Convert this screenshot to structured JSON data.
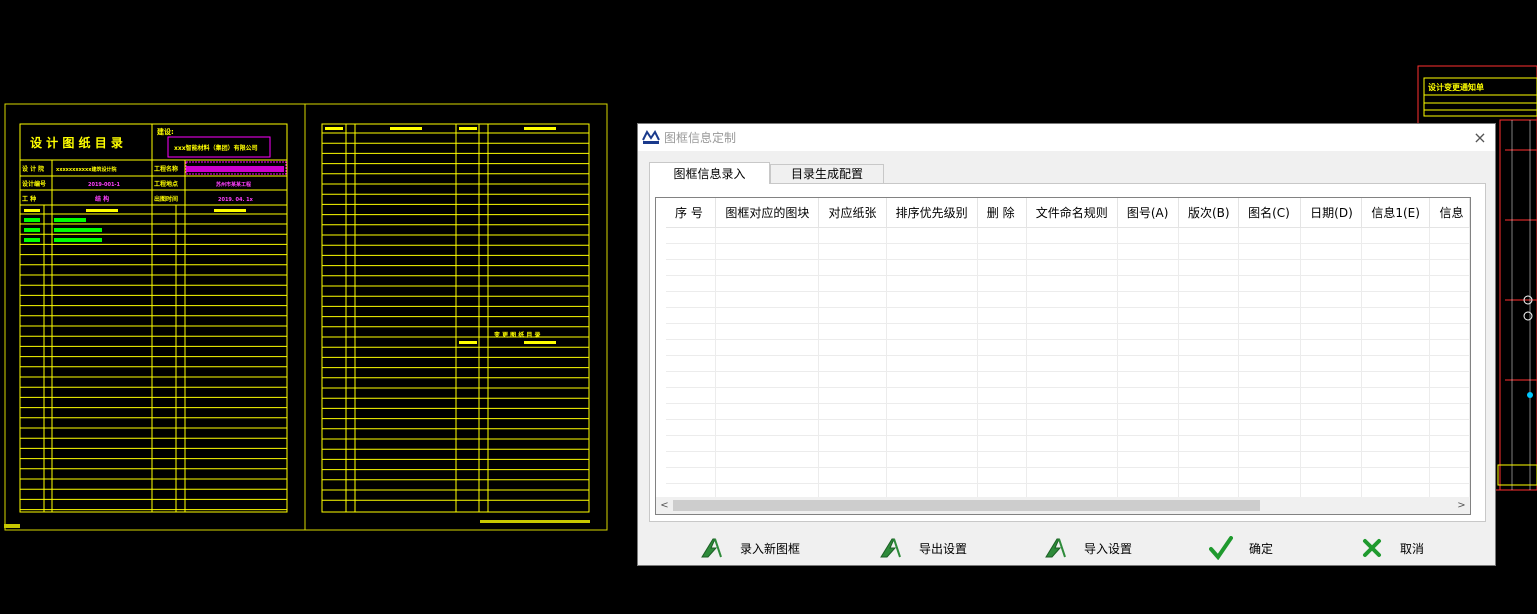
{
  "cad": {
    "catalog_title": "设 计 图 纸 目 录",
    "owner_label": "建设:",
    "company": "xxx智能材料（集团）有限公司",
    "row1_label": "设 计 院",
    "row1_value": "xxxxxxxxxxx建筑设计院",
    "row2_label": "设计编号",
    "row2_value": "2019-001-1",
    "row3_label": "工    种",
    "row3_value": "结 构",
    "project_name_label": "工程名称",
    "project_site_label": "工程地点",
    "project_site_value": "苏州市某某工程",
    "date_label": "出图时间",
    "date_value": "2019. 04. 1x",
    "right_sheet_note": "变 更 图 纸 目 录",
    "change_notice_title": "设计变更通知单"
  },
  "dialog": {
    "title": "图框信息定制",
    "close": "×",
    "tabs": [
      {
        "label": "图框信息录入",
        "active": true
      },
      {
        "label": "目录生成配置",
        "active": false
      }
    ],
    "columns": [
      "序 号",
      "图框对应的图块",
      "对应纸张",
      "排序优先级别",
      "删 除",
      "文件命名规则",
      "图号(A)",
      "版次(B)",
      "图名(C)",
      "日期(D)",
      "信息1(E)",
      "信息"
    ],
    "scroll_left": "<",
    "scroll_right": ">",
    "buttons": {
      "add_frame": "录入新图框",
      "export": "导出设置",
      "import": "导入设置",
      "ok": "确定",
      "cancel": "取消"
    },
    "icons": {
      "add_frame": "a-tool-icon",
      "export": "a-tool-icon",
      "import": "a-tool-icon",
      "ok": "checkmark-icon",
      "cancel": "x-icon"
    }
  }
}
